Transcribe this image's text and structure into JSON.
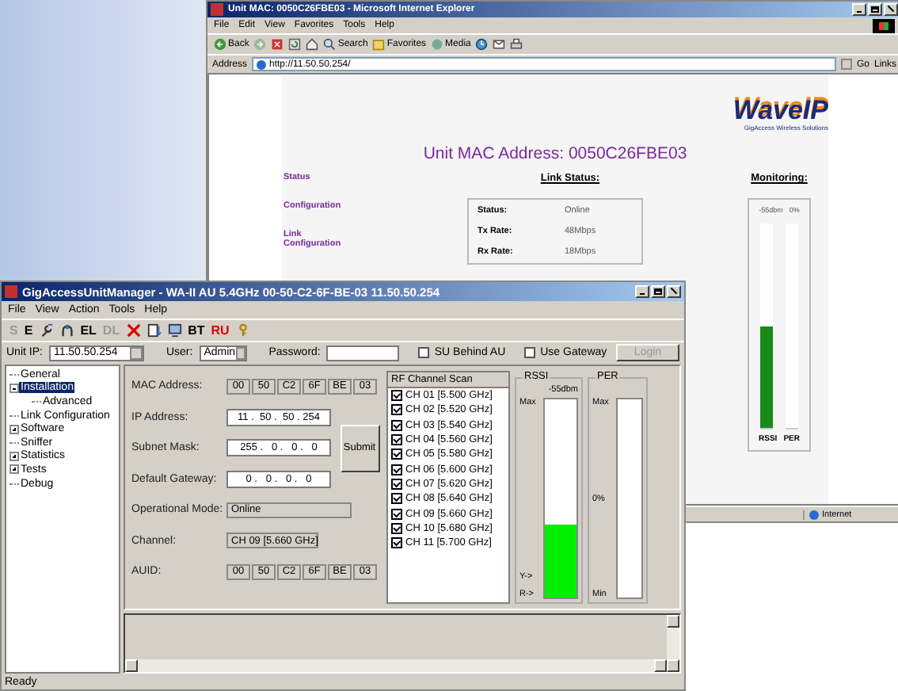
{
  "ie_window": {
    "title": "Unit MAC: 0050C26FBE03 - Microsoft Internet Explorer",
    "menu": [
      "File",
      "Edit",
      "View",
      "Favorites",
      "Tools",
      "Help"
    ],
    "toolbar": [
      {
        "kind": "back",
        "label": "Back"
      },
      {
        "kind": "forward"
      },
      {
        "kind": "stop"
      },
      {
        "kind": "refresh"
      },
      {
        "kind": "home"
      },
      {
        "kind": "search",
        "label": "Search"
      },
      {
        "kind": "favorites",
        "label": "Favorites"
      },
      {
        "kind": "media",
        "label": "Media"
      },
      {
        "kind": "history"
      },
      {
        "kind": "mail"
      },
      {
        "kind": "print"
      }
    ],
    "address": {
      "label": "Address",
      "value": "http://11.50.50.254/",
      "go": "Go",
      "links": "Links"
    },
    "page": {
      "logo": {
        "wordmark": "WaveIP",
        "tagline": "GigAccess Wireless Solutions"
      },
      "heading": "Unit MAC Address: 0050C26FBE03",
      "nav": [
        "Status",
        "Configuration",
        "Link Configuration"
      ],
      "link_status": {
        "title": "Link Status:",
        "rows": [
          {
            "label": "Status:",
            "value": "Online"
          },
          {
            "label": "Tx Rate:",
            "value": "48Mbps"
          },
          {
            "label": "Rx Rate:",
            "value": "18Mbps"
          }
        ]
      },
      "monitoring": {
        "title": "Monitoring:",
        "readings": [
          "-55dbm",
          "0%"
        ],
        "bars": [
          {
            "label": "RSSI",
            "level": 0.5
          },
          {
            "label": "PER",
            "level": 0
          }
        ]
      }
    },
    "status_bar": {
      "zone": "Internet"
    }
  },
  "app_window": {
    "title": "GigAccessUnitManager - WA-II AU 5.4GHz 00-50-C2-6F-BE-03  11.50.50.254",
    "menu": [
      "File",
      "View",
      "Action",
      "Tools",
      "Help"
    ],
    "toolbar": [
      {
        "kind": "text",
        "label": "S",
        "disabled": true
      },
      {
        "kind": "text",
        "label": "E",
        "disabled": false
      },
      {
        "kind": "wrench"
      },
      {
        "kind": "plug"
      },
      {
        "kind": "text",
        "label": "EL",
        "disabled": false
      },
      {
        "kind": "text",
        "label": "DL",
        "disabled": true
      },
      {
        "kind": "delete"
      },
      {
        "kind": "download"
      },
      {
        "kind": "monitor"
      },
      {
        "kind": "text",
        "label": "BT",
        "disabled": false
      },
      {
        "kind": "text",
        "label": "RU",
        "disabled": false,
        "color": "#dd0000"
      },
      {
        "kind": "key"
      }
    ],
    "connection": {
      "unit_ip_label": "Unit IP:",
      "unit_ip": "11.50.50.254",
      "user_label": "User:",
      "user": "Admin",
      "password_label": "Password:",
      "options": [
        {
          "label": "SU Behind AU",
          "checked": false
        },
        {
          "label": "Use Gateway",
          "checked": false
        }
      ],
      "login": {
        "label": "Login",
        "disabled": true
      }
    },
    "tree": [
      {
        "label": "General",
        "selected": false
      },
      {
        "label": "Installation",
        "selected": true,
        "expanded": true,
        "children": [
          {
            "label": "Advanced",
            "selected": false
          }
        ]
      },
      {
        "label": "Link Configuration",
        "selected": false
      },
      {
        "label": "Software",
        "selected": false,
        "expanded": false
      },
      {
        "label": "Sniffer",
        "selected": false
      },
      {
        "label": "Statistics",
        "selected": false,
        "expanded": false
      },
      {
        "label": "Tests",
        "selected": false,
        "expanded": false
      },
      {
        "label": "Debug",
        "selected": false
      }
    ],
    "form": {
      "fields": [
        {
          "kind": "octets",
          "label": "MAC Address:",
          "parts": [
            "00",
            "50",
            "C2",
            "6F",
            "BE",
            "03"
          ]
        },
        {
          "kind": "ip",
          "label": "IP Address:",
          "value": "11 .  50 .  50 . 254"
        },
        {
          "kind": "ip",
          "label": "Subnet Mask:",
          "value": "255 .   0 .   0 .   0"
        },
        {
          "kind": "ip",
          "label": "Default Gateway:",
          "value": "0 .   0 .   0 .   0"
        },
        {
          "kind": "readonly",
          "label": "Operational Mode:",
          "value": "Online"
        },
        {
          "kind": "readonly",
          "label": "Channel:",
          "value": "CH 09 [5.660 GHz]"
        },
        {
          "kind": "octets",
          "label": "AUID:",
          "parts": [
            "00",
            "50",
            "C2",
            "6F",
            "BE",
            "03"
          ]
        }
      ],
      "submit": "Submit"
    },
    "rf_scan": {
      "title": "RF Channel Scan",
      "channels": [
        {
          "label": "CH 01 [5.500 GHz]",
          "checked": true
        },
        {
          "label": "CH 02 [5.520 GHz]",
          "checked": true
        },
        {
          "label": "CH 03 [5.540 GHz]",
          "checked": true
        },
        {
          "label": "CH 04 [5.560 GHz]",
          "checked": true
        },
        {
          "label": "CH 05 [5.580 GHz]",
          "checked": true
        },
        {
          "label": "CH 06 [5.600 GHz]",
          "checked": true
        },
        {
          "label": "CH 07 [5.620 GHz]",
          "checked": true
        },
        {
          "label": "CH 08 [5.640 GHz]",
          "checked": true
        },
        {
          "label": "CH 09 [5.660 GHz]",
          "checked": true
        },
        {
          "label": "CH 10 [5.680 GHz]",
          "checked": true
        },
        {
          "label": "CH 11 [5.700 GHz]",
          "checked": true
        }
      ]
    },
    "rssi": {
      "title": "RSSI",
      "reading": "-55dbm",
      "max": "Max",
      "markers": [
        "Y->",
        "R->"
      ],
      "level": 0.37
    },
    "per": {
      "title": "PER",
      "max": "Max",
      "reading": "0%",
      "min": "Min",
      "level": 0
    },
    "status_bar": "Ready"
  }
}
